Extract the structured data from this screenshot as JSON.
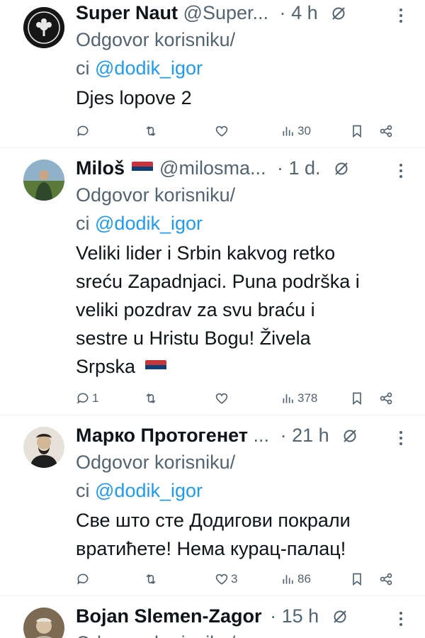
{
  "tweets": [
    {
      "name": "Super Naut",
      "handle": "@Super...",
      "dot": "·",
      "time": "4 h",
      "reply_prefix": "Odgovor korisniku/",
      "reply_prefix2": "ci",
      "mention": "@dodik_igor",
      "text_lines": [
        "Djes lopove 2"
      ],
      "stats": {
        "replies": "",
        "retweets": "",
        "likes": "",
        "views": "30"
      }
    },
    {
      "name": "Miloš",
      "handle": "@milosma...",
      "dot": "·",
      "time": "1 d.",
      "reply_prefix": "Odgovor korisniku/",
      "reply_prefix2": "ci",
      "mention": "@dodik_igor",
      "text_lines": [
        "Veliki lider i Srbin kakvog retko",
        "sreću Zapadnjaci. Puna podrška i",
        "veliki pozdrav za svu braću i",
        "sestre u Hristu Bogu! Živela",
        "Srpska"
      ],
      "stats": {
        "replies": "1",
        "retweets": "",
        "likes": "",
        "views": "378"
      }
    },
    {
      "name": "Марко Протогенет",
      "handle": "...",
      "dot": "·",
      "time": "21 h",
      "reply_prefix": "Odgovor korisniku/",
      "reply_prefix2": "ci",
      "mention": "@dodik_igor",
      "text_lines": [
        "Све што сте Додигови покрали",
        "вратићете! Нема курац-палац!"
      ],
      "stats": {
        "replies": "",
        "retweets": "",
        "likes": "3",
        "views": "86"
      }
    },
    {
      "name": "Bojan Slemen-Zagor",
      "handle": "",
      "dot": "·",
      "time": "15 h",
      "reply_prefix": "Odgovor korisniku/"
    }
  ],
  "icons": {
    "reply": "reply-icon",
    "retweet": "retweet-icon",
    "like": "heart-icon",
    "views": "views-icon",
    "bookmark": "bookmark-icon",
    "share": "share-icon",
    "grok": "grok-icon",
    "more": "more-vertical-icon"
  },
  "colors": {
    "text": "#0f1419",
    "muted": "#536471",
    "link": "#1d9bf0",
    "divider": "#eff3f4",
    "flag_red": "#c6363c",
    "flag_blue": "#0c4076",
    "flag_white": "#ffffff"
  }
}
